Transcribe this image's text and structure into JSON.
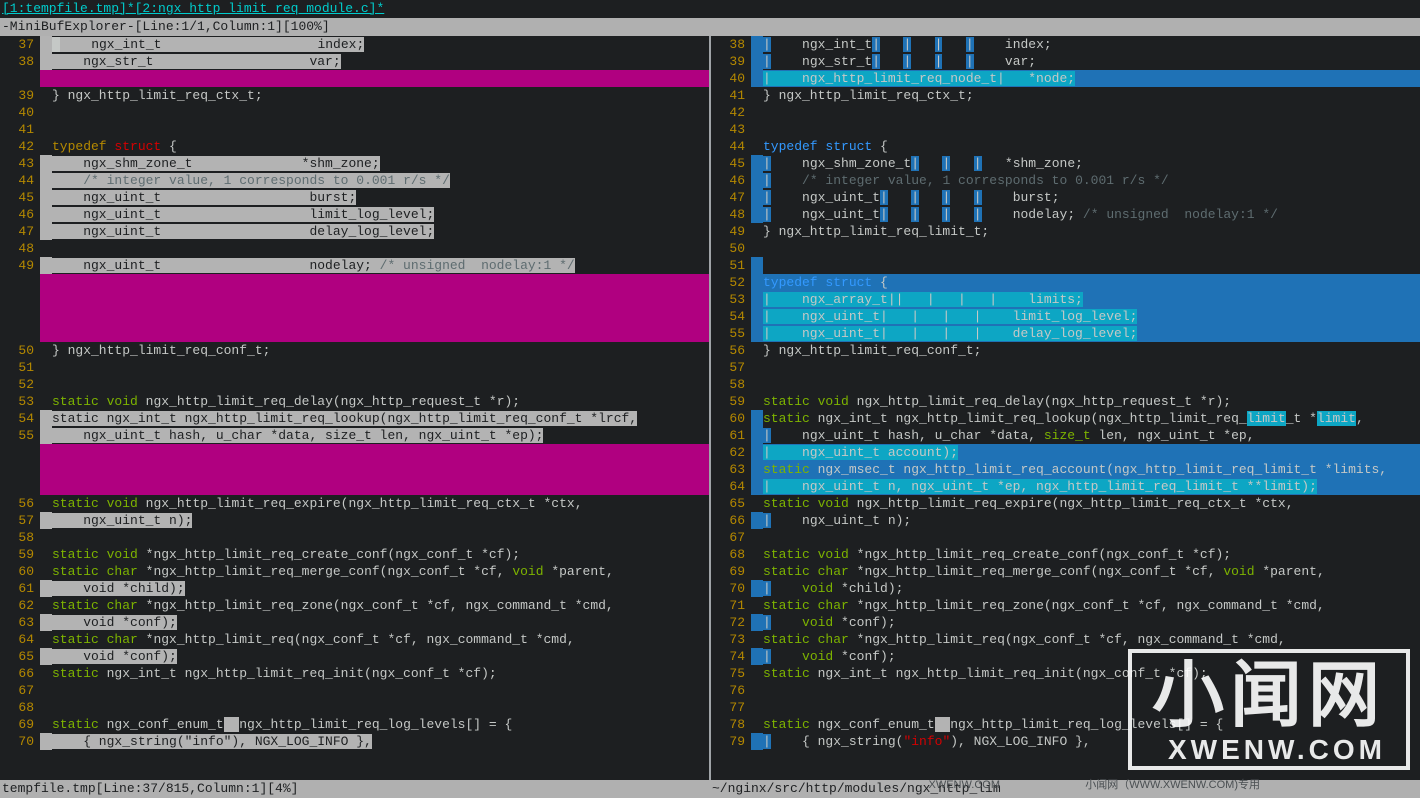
{
  "topbar": {
    "tabs_text": "[1:tempfile.tmp]*[2:ngx_http_limit_req_module.c]*"
  },
  "minibuf": "-MiniBufExplorer-[Line:1/1,Column:1][100%]",
  "status_left": "tempfile.tmp[Line:37/815,Column:1][4%]",
  "status_right": "~/nginx/src/http/modules/ngx_http_lim",
  "watermark_cn": "小闻网",
  "watermark_en": "XWENW.COM",
  "watermark_sub1": "小闻网（WWW.XWENW.COM)专用",
  "watermark_sub2": "XWENW.COM",
  "left_lines": [
    {
      "n": 37,
      "diff": "grey",
      "cursor": true,
      "segs": [
        {
          "cls": "hl-grey",
          "t": "    ngx_int_t                    index;"
        }
      ]
    },
    {
      "n": 38,
      "diff": "grey",
      "segs": [
        {
          "cls": "hl-grey",
          "t": "    ngx_str_t                    var;"
        }
      ]
    },
    {
      "n": "",
      "diff": "mag",
      "full": "magenta"
    },
    {
      "n": 39,
      "segs": [
        {
          "t": "} ngx_http_limit_req_ctx_t;"
        }
      ]
    },
    {
      "n": 40
    },
    {
      "n": 41
    },
    {
      "n": 42,
      "segs": [
        {
          "cls": "kw-yellow",
          "t": "typedef"
        },
        {
          "t": " "
        },
        {
          "cls": "kw-red",
          "t": "struct"
        },
        {
          "t": " {"
        }
      ]
    },
    {
      "n": 43,
      "diff": "grey",
      "segs": [
        {
          "cls": "hl-grey",
          "t": "    ngx_shm_zone_t              *shm_zone;"
        }
      ]
    },
    {
      "n": 44,
      "diff": "grey",
      "segs": [
        {
          "cls": "hl-grey",
          "t": "    "
        },
        {
          "cls": "hl-grey comment",
          "t": "/* integer value, 1 corresponds to 0.001 r/s */"
        }
      ]
    },
    {
      "n": 45,
      "diff": "grey",
      "segs": [
        {
          "cls": "hl-grey",
          "t": "    ngx_uint_t                   burst;"
        }
      ]
    },
    {
      "n": 46,
      "diff": "grey",
      "segs": [
        {
          "cls": "hl-grey",
          "t": "    ngx_uint_t                   limit_log_level;"
        }
      ]
    },
    {
      "n": 47,
      "diff": "grey",
      "segs": [
        {
          "cls": "hl-grey",
          "t": "    ngx_uint_t                   delay_log_level;"
        }
      ]
    },
    {
      "n": 48
    },
    {
      "n": 49,
      "diff": "grey",
      "segs": [
        {
          "cls": "hl-grey",
          "t": "    ngx_uint_t                   nodelay; "
        },
        {
          "cls": "hl-grey comment",
          "t": "/* unsigned  nodelay:1 */"
        }
      ]
    },
    {
      "n": "",
      "diff": "mag",
      "full": "magenta"
    },
    {
      "n": "",
      "diff": "mag",
      "full": "magenta"
    },
    {
      "n": "",
      "diff": "mag",
      "full": "magenta"
    },
    {
      "n": "",
      "diff": "mag",
      "full": "magenta"
    },
    {
      "n": 50,
      "segs": [
        {
          "t": "} ngx_http_limit_req_conf_t;"
        }
      ]
    },
    {
      "n": 51
    },
    {
      "n": 52
    },
    {
      "n": 53,
      "segs": [
        {
          "cls": "kw-green",
          "t": "static"
        },
        {
          "t": " "
        },
        {
          "cls": "kw-green",
          "t": "void"
        },
        {
          "t": " ngx_http_limit_req_delay(ngx_http_request_t *r);"
        }
      ]
    },
    {
      "n": 54,
      "diff": "grey",
      "segs": [
        {
          "cls": "hl-grey",
          "t": "static ngx_int_t ngx_http_limit_req_lookup(ngx_http_limit_req_conf_t *lrcf,"
        }
      ]
    },
    {
      "n": 55,
      "diff": "grey",
      "segs": [
        {
          "cls": "hl-grey",
          "t": "    ngx_uint_t hash, u_char *data, size_t len, ngx_uint_t *ep);"
        }
      ]
    },
    {
      "n": "",
      "diff": "mag",
      "full": "magenta"
    },
    {
      "n": "",
      "diff": "mag",
      "full": "magenta"
    },
    {
      "n": "",
      "diff": "mag",
      "full": "magenta"
    },
    {
      "n": 56,
      "segs": [
        {
          "cls": "kw-green",
          "t": "static"
        },
        {
          "t": " "
        },
        {
          "cls": "kw-green",
          "t": "void"
        },
        {
          "t": " ngx_http_limit_req_expire(ngx_http_limit_req_ctx_t *ctx,"
        }
      ]
    },
    {
      "n": 57,
      "diff": "grey",
      "segs": [
        {
          "cls": "hl-grey",
          "t": "    ngx_uint_t n);"
        }
      ]
    },
    {
      "n": 58
    },
    {
      "n": 59,
      "segs": [
        {
          "cls": "kw-green",
          "t": "static"
        },
        {
          "t": " "
        },
        {
          "cls": "kw-green",
          "t": "void"
        },
        {
          "t": " *ngx_http_limit_req_create_conf(ngx_conf_t *cf);"
        }
      ]
    },
    {
      "n": 60,
      "segs": [
        {
          "cls": "kw-green",
          "t": "static"
        },
        {
          "t": " "
        },
        {
          "cls": "kw-green",
          "t": "char"
        },
        {
          "t": " *ngx_http_limit_req_merge_conf(ngx_conf_t *cf, "
        },
        {
          "cls": "kw-green",
          "t": "void"
        },
        {
          "t": " *parent,"
        }
      ]
    },
    {
      "n": 61,
      "diff": "grey",
      "segs": [
        {
          "cls": "hl-grey",
          "t": "    void *child);"
        }
      ]
    },
    {
      "n": 62,
      "segs": [
        {
          "cls": "kw-green",
          "t": "static"
        },
        {
          "t": " "
        },
        {
          "cls": "kw-green",
          "t": "char"
        },
        {
          "t": " *ngx_http_limit_req_zone(ngx_conf_t *cf, ngx_command_t *cmd,"
        }
      ]
    },
    {
      "n": 63,
      "diff": "grey",
      "segs": [
        {
          "cls": "hl-grey",
          "t": "    void *conf);"
        }
      ]
    },
    {
      "n": 64,
      "segs": [
        {
          "cls": "kw-green",
          "t": "static"
        },
        {
          "t": " "
        },
        {
          "cls": "kw-green",
          "t": "char"
        },
        {
          "t": " *ngx_http_limit_req(ngx_conf_t *cf, ngx_command_t *cmd,"
        }
      ]
    },
    {
      "n": 65,
      "diff": "grey",
      "segs": [
        {
          "cls": "hl-grey",
          "t": "    void *conf);"
        }
      ]
    },
    {
      "n": 66,
      "segs": [
        {
          "cls": "kw-green",
          "t": "static"
        },
        {
          "t": " ngx_int_t ngx_http_limit_req_init(ngx_conf_t *cf);"
        }
      ]
    },
    {
      "n": 67
    },
    {
      "n": 68
    },
    {
      "n": 69,
      "segs": [
        {
          "cls": "kw-green",
          "t": "static"
        },
        {
          "t": " ngx_conf_enum_t"
        },
        {
          "cls": "hl-grey",
          "t": "  "
        },
        {
          "t": "ngx_http_limit_req_log_levels[] = {"
        }
      ]
    },
    {
      "n": 70,
      "diff": "grey",
      "segs": [
        {
          "cls": "hl-grey",
          "t": "    { ngx_string(\"info\"), NGX_LOG_INFO },"
        }
      ]
    }
  ],
  "right_lines": [
    {
      "n": 38,
      "diff": "blueL",
      "segs": [
        {
          "cls": "pipe-bg",
          "t": "|"
        },
        {
          "t": "    ngx_int_t"
        },
        {
          "cls": "pipe-bg",
          "t": "|"
        },
        {
          "t": "   "
        },
        {
          "cls": "pipe-bg",
          "t": "|"
        },
        {
          "t": "   "
        },
        {
          "cls": "pipe-bg",
          "t": "|"
        },
        {
          "t": "   "
        },
        {
          "cls": "pipe-bg",
          "t": "|"
        },
        {
          "t": "    index;"
        }
      ]
    },
    {
      "n": 39,
      "diff": "blueL",
      "segs": [
        {
          "cls": "pipe-bg",
          "t": "|"
        },
        {
          "t": "    ngx_str_t"
        },
        {
          "cls": "pipe-bg",
          "t": "|"
        },
        {
          "t": "   "
        },
        {
          "cls": "pipe-bg",
          "t": "|"
        },
        {
          "t": "   "
        },
        {
          "cls": "pipe-bg",
          "t": "|"
        },
        {
          "t": "   "
        },
        {
          "cls": "pipe-bg",
          "t": "|"
        },
        {
          "t": "    var;"
        }
      ]
    },
    {
      "n": 40,
      "diff": "blueL",
      "full": "blue",
      "segs": [
        {
          "cls": "pipe-cy",
          "t": "|    ngx_http_limit_req_node_t|   *node;"
        }
      ]
    },
    {
      "n": 41,
      "segs": [
        {
          "t": "} ngx_http_limit_req_ctx_t;"
        }
      ]
    },
    {
      "n": 42
    },
    {
      "n": 43
    },
    {
      "n": 44,
      "segs": [
        {
          "cls": "kw-blue",
          "t": "typedef"
        },
        {
          "t": " "
        },
        {
          "cls": "kw-blue",
          "t": "struct"
        },
        {
          "t": " {"
        }
      ]
    },
    {
      "n": 45,
      "diff": "blueL",
      "segs": [
        {
          "cls": "pipe-bg",
          "t": "|"
        },
        {
          "t": "    ngx_shm_zone_t"
        },
        {
          "cls": "pipe-bg",
          "t": "|"
        },
        {
          "t": "   "
        },
        {
          "cls": "pipe-bg",
          "t": "|"
        },
        {
          "t": "   "
        },
        {
          "cls": "pipe-bg",
          "t": "|"
        },
        {
          "t": "   *shm_zone;"
        }
      ]
    },
    {
      "n": 46,
      "diff": "blueL",
      "segs": [
        {
          "cls": "pipe-bg",
          "t": "|"
        },
        {
          "t": "    "
        },
        {
          "cls": "comment",
          "t": "/* integer value, 1 corresponds to 0.001 r/s */"
        }
      ]
    },
    {
      "n": 47,
      "diff": "blueL",
      "segs": [
        {
          "cls": "pipe-bg",
          "t": "|"
        },
        {
          "t": "    ngx_uint_t"
        },
        {
          "cls": "pipe-bg",
          "t": "|"
        },
        {
          "t": "   "
        },
        {
          "cls": "pipe-bg",
          "t": "|"
        },
        {
          "t": "   "
        },
        {
          "cls": "pipe-bg",
          "t": "|"
        },
        {
          "t": "   "
        },
        {
          "cls": "pipe-bg",
          "t": "|"
        },
        {
          "t": "    burst;"
        }
      ]
    },
    {
      "n": 48,
      "diff": "blueL",
      "segs": [
        {
          "cls": "pipe-bg",
          "t": "|"
        },
        {
          "t": "    ngx_uint_t"
        },
        {
          "cls": "pipe-bg",
          "t": "|"
        },
        {
          "t": "   "
        },
        {
          "cls": "pipe-bg",
          "t": "|"
        },
        {
          "t": "   "
        },
        {
          "cls": "pipe-bg",
          "t": "|"
        },
        {
          "t": "   "
        },
        {
          "cls": "pipe-bg",
          "t": "|"
        },
        {
          "t": "    nodelay; "
        },
        {
          "cls": "comment",
          "t": "/* unsigned  nodelay:1 */"
        }
      ]
    },
    {
      "n": 49,
      "segs": [
        {
          "t": "} ngx_http_limit_req_limit_t;"
        }
      ]
    },
    {
      "n": 50
    },
    {
      "n": 51,
      "diff": "blueL"
    },
    {
      "n": 52,
      "diff": "blueL",
      "full": "blue",
      "segs": [
        {
          "cls": "kw-blue",
          "t": "typedef"
        },
        {
          "t": " "
        },
        {
          "cls": "kw-blue",
          "t": "struct"
        },
        {
          "t": " {"
        }
      ]
    },
    {
      "n": 53,
      "diff": "blueL",
      "full": "blue",
      "segs": [
        {
          "cls": "pipe-cy",
          "t": "|    ngx_array_t||   |   |   |    limits;"
        }
      ]
    },
    {
      "n": 54,
      "diff": "blueL",
      "full": "blue",
      "segs": [
        {
          "cls": "pipe-cy",
          "t": "|    ngx_uint_t|   |   |   |    limit_log_level;"
        }
      ]
    },
    {
      "n": 55,
      "diff": "blueL",
      "full": "blue",
      "segs": [
        {
          "cls": "pipe-cy",
          "t": "|    ngx_uint_t|   |   |   |    delay_log_level;"
        }
      ]
    },
    {
      "n": 56,
      "segs": [
        {
          "t": "} ngx_http_limit_req_conf_t;"
        }
      ]
    },
    {
      "n": 57
    },
    {
      "n": 58
    },
    {
      "n": 59,
      "segs": [
        {
          "cls": "kw-green",
          "t": "static"
        },
        {
          "t": " "
        },
        {
          "cls": "kw-green",
          "t": "void"
        },
        {
          "t": " ngx_http_limit_req_delay(ngx_http_request_t *r);"
        }
      ]
    },
    {
      "n": 60,
      "diff": "blueL",
      "segs": [
        {
          "cls": "kw-green",
          "t": "static"
        },
        {
          "t": " ngx_int_t ngx_http_limit_req_lookup(ngx_http_limit_req_"
        },
        {
          "cls": "hl-cyan-bg",
          "t": "limit"
        },
        {
          "t": "_t *"
        },
        {
          "cls": "hl-cyan-bg",
          "t": "limit"
        },
        {
          "t": ","
        }
      ]
    },
    {
      "n": 61,
      "diff": "blueL",
      "segs": [
        {
          "cls": "pipe-bg",
          "t": "|"
        },
        {
          "t": "    ngx_uint_t hash, u_char *data, "
        },
        {
          "cls": "kw-green",
          "t": "size_t"
        },
        {
          "t": " len, ngx_uint_t *ep,"
        }
      ]
    },
    {
      "n": 62,
      "diff": "blueL",
      "full": "blue",
      "segs": [
        {
          "cls": "pipe-cy",
          "t": "|    ngx_uint_t account);"
        }
      ]
    },
    {
      "n": 63,
      "diff": "blueL",
      "full": "blue",
      "segs": [
        {
          "cls": "kw-green",
          "t": "static"
        },
        {
          "t": " ngx_msec_t ngx_http_limit_req_account(ngx_http_limit_req_limit_t *limits,"
        }
      ]
    },
    {
      "n": 64,
      "diff": "blueL",
      "full": "blue",
      "segs": [
        {
          "cls": "pipe-cy",
          "t": "|    ngx_uint_t n, ngx_uint_t *ep, ngx_http_limit_req_limit_t **limit);"
        }
      ]
    },
    {
      "n": 65,
      "segs": [
        {
          "cls": "kw-green",
          "t": "static"
        },
        {
          "t": " "
        },
        {
          "cls": "kw-green",
          "t": "void"
        },
        {
          "t": " ngx_http_limit_req_expire(ngx_http_limit_req_ctx_t *ctx,"
        }
      ]
    },
    {
      "n": 66,
      "diff": "blueL",
      "segs": [
        {
          "cls": "pipe-bg",
          "t": "|"
        },
        {
          "t": "    ngx_uint_t n);"
        }
      ]
    },
    {
      "n": 67
    },
    {
      "n": 68,
      "segs": [
        {
          "cls": "kw-green",
          "t": "static"
        },
        {
          "t": " "
        },
        {
          "cls": "kw-green",
          "t": "void"
        },
        {
          "t": " *ngx_http_limit_req_create_conf(ngx_conf_t *cf);"
        }
      ]
    },
    {
      "n": 69,
      "segs": [
        {
          "cls": "kw-green",
          "t": "static"
        },
        {
          "t": " "
        },
        {
          "cls": "kw-green",
          "t": "char"
        },
        {
          "t": " *ngx_http_limit_req_merge_conf(ngx_conf_t *cf, "
        },
        {
          "cls": "kw-green",
          "t": "void"
        },
        {
          "t": " *parent,"
        }
      ]
    },
    {
      "n": 70,
      "diff": "blueL",
      "segs": [
        {
          "cls": "pipe-bg",
          "t": "|"
        },
        {
          "t": "    "
        },
        {
          "cls": "kw-green",
          "t": "void"
        },
        {
          "t": " *child);"
        }
      ]
    },
    {
      "n": 71,
      "segs": [
        {
          "cls": "kw-green",
          "t": "static"
        },
        {
          "t": " "
        },
        {
          "cls": "kw-green",
          "t": "char"
        },
        {
          "t": " *ngx_http_limit_req_zone(ngx_conf_t *cf, ngx_command_t *cmd,"
        }
      ]
    },
    {
      "n": 72,
      "diff": "blueL",
      "segs": [
        {
          "cls": "pipe-bg",
          "t": "|"
        },
        {
          "t": "    "
        },
        {
          "cls": "kw-green",
          "t": "void"
        },
        {
          "t": " *conf);"
        }
      ]
    },
    {
      "n": 73,
      "segs": [
        {
          "cls": "kw-green",
          "t": "static"
        },
        {
          "t": " "
        },
        {
          "cls": "kw-green",
          "t": "char"
        },
        {
          "t": " *ngx_http_limit_req(ngx_conf_t *cf, ngx_command_t *cmd,"
        }
      ]
    },
    {
      "n": 74,
      "diff": "blueL",
      "segs": [
        {
          "cls": "pipe-bg",
          "t": "|"
        },
        {
          "t": "    "
        },
        {
          "cls": "kw-green",
          "t": "void"
        },
        {
          "t": " *conf);"
        }
      ]
    },
    {
      "n": 75,
      "segs": [
        {
          "cls": "kw-green",
          "t": "static"
        },
        {
          "t": " ngx_int_t ngx_http_limit_req_init(ngx_conf_t *cf);"
        }
      ]
    },
    {
      "n": 76
    },
    {
      "n": 77
    },
    {
      "n": 78,
      "segs": [
        {
          "cls": "kw-green",
          "t": "static"
        },
        {
          "t": " ngx_conf_enum_t"
        },
        {
          "cls": "hl-grey",
          "t": "  "
        },
        {
          "t": "ngx_http_limit_req_log_levels[] = {"
        }
      ]
    },
    {
      "n": 79,
      "diff": "blueL",
      "segs": [
        {
          "cls": "pipe-bg",
          "t": "|"
        },
        {
          "t": "    { ngx_string("
        },
        {
          "cls": "kw-red",
          "t": "\"info\""
        },
        {
          "t": "), NGX_LOG_INFO },"
        }
      ]
    }
  ]
}
